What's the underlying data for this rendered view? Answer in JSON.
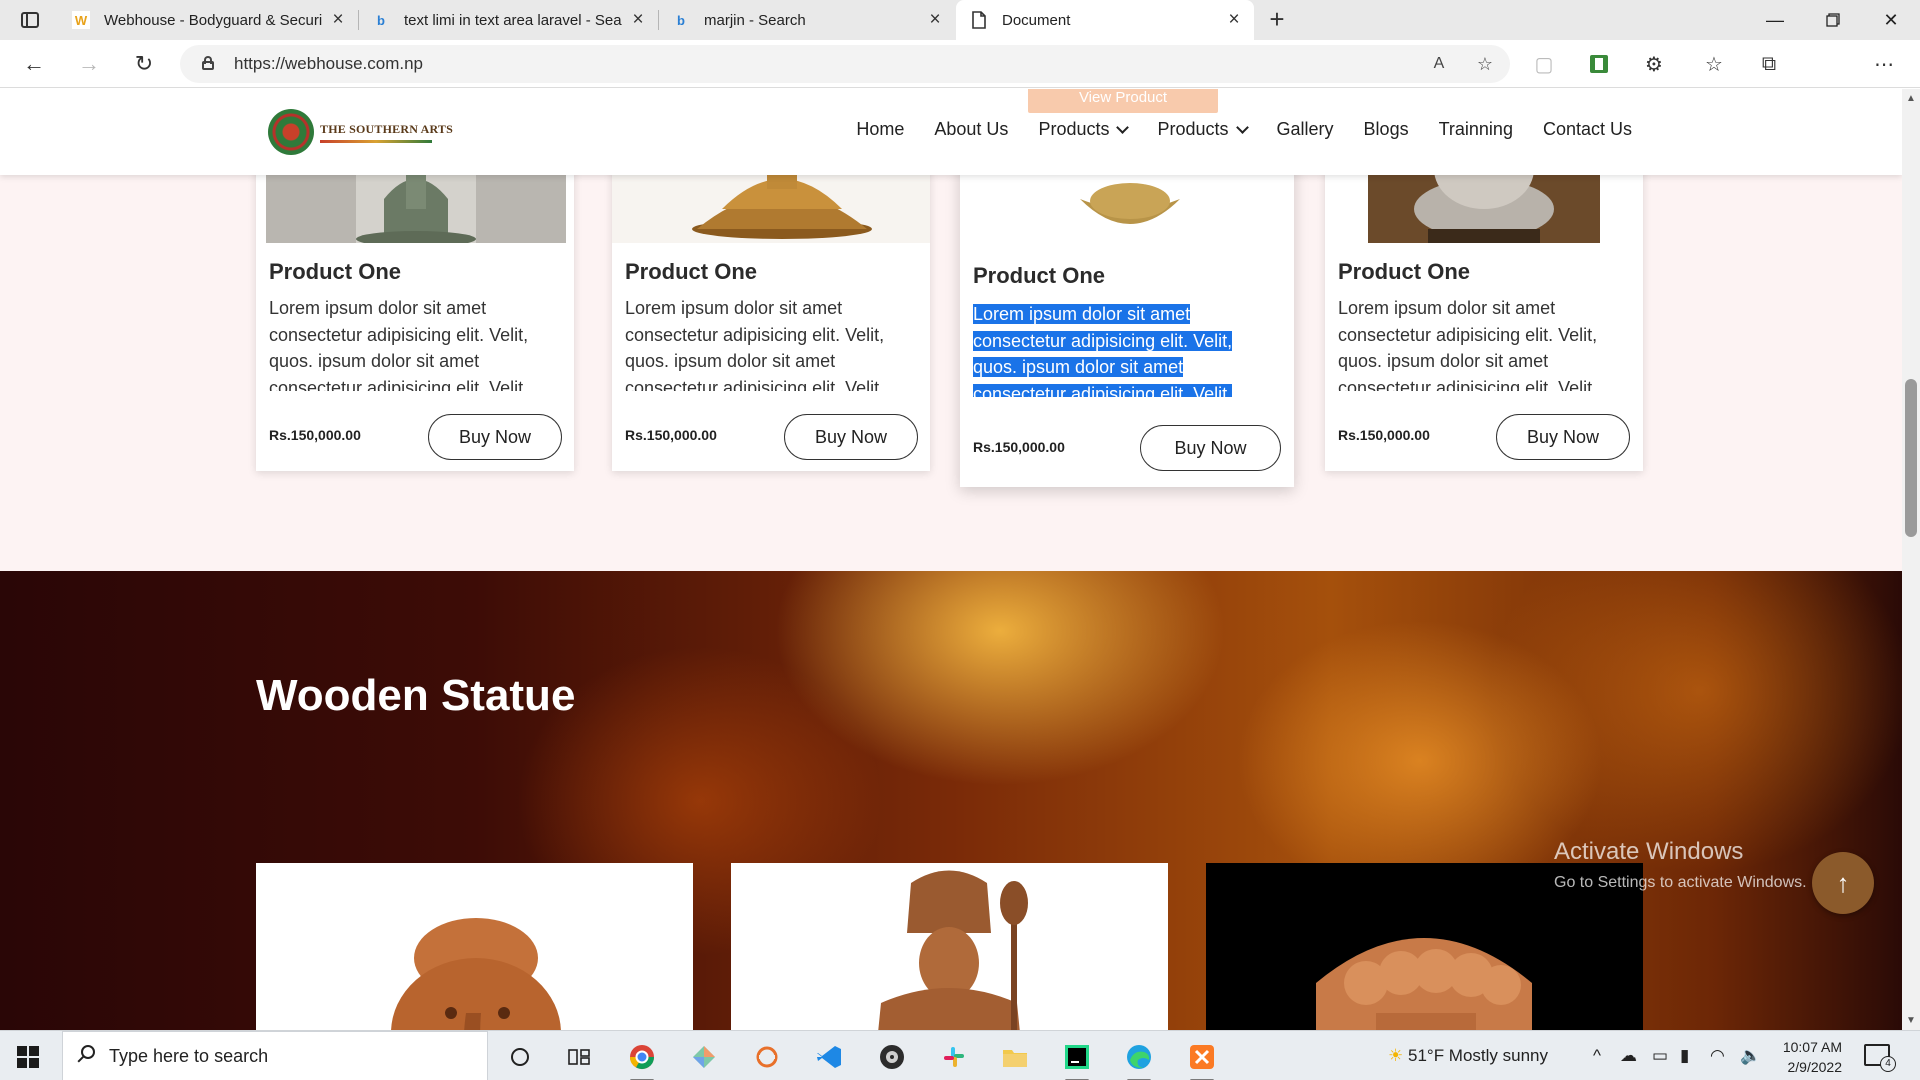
{
  "browser": {
    "tabs": [
      {
        "title": "Webhouse - Bodyguard & Securi",
        "favicon": "w-logo-icon",
        "active": false
      },
      {
        "title": "text limi in text area laravel - Sea",
        "favicon": "bing-icon",
        "active": false
      },
      {
        "title": "marjin - Search",
        "favicon": "bing-icon",
        "active": false
      },
      {
        "title": "Document",
        "favicon": "document-icon",
        "active": true
      }
    ],
    "new_tab": "+",
    "url": "https://webhouse.com.np"
  },
  "site": {
    "logo_text": "THE SOUTHERN ARTS",
    "nav": [
      "Home",
      "About Us",
      "Products",
      "Products",
      "Gallery",
      "Blogs",
      "Trainning",
      "Contact Us"
    ],
    "peek_label": "View Product",
    "products": [
      {
        "name": "Product One",
        "description": "Lorem ipsum dolor sit amet consectetur adipisicing elit. Velit, quos. ipsum dolor sit amet consectetur adipisicing elit. Velit,",
        "price": "Rs.150,000.00",
        "button": "Buy Now"
      },
      {
        "name": "Product One",
        "description": "Lorem ipsum dolor sit amet consectetur adipisicing elit. Velit, quos. ipsum dolor sit amet consectetur adipisicing elit. Velit,",
        "price": "Rs.150,000.00",
        "button": "Buy Now"
      },
      {
        "name": "Product One",
        "description": "Lorem ipsum dolor sit amet consectetur adipisicing elit. Velit, quos. ipsum dolor sit amet consectetur adipisicing elit. Velit,",
        "price": "Rs.150,000.00",
        "button": "Buy Now"
      },
      {
        "name": "Product One",
        "description": "Lorem ipsum dolor sit amet consectetur adipisicing elit. Velit, quos. ipsum dolor sit amet consectetur adipisicing elit. Velit,",
        "price": "Rs.150,000.00",
        "button": "Buy Now"
      }
    ],
    "section_title": "Wooden Statue",
    "back_to_top": "↑"
  },
  "overlay": {
    "activate_title": "Activate Windows",
    "activate_sub": "Go to Settings to activate Windows."
  },
  "taskbar": {
    "search_placeholder": "Type here to search",
    "weather": "51°F  Mostly sunny",
    "time": "10:07 AM",
    "date": "2/9/2022",
    "notification_count": "4"
  },
  "colors": {
    "accent_selection": "#1a73e8",
    "page_bg": "#fdf3f3",
    "to_top_button": "#8b5a2b"
  }
}
